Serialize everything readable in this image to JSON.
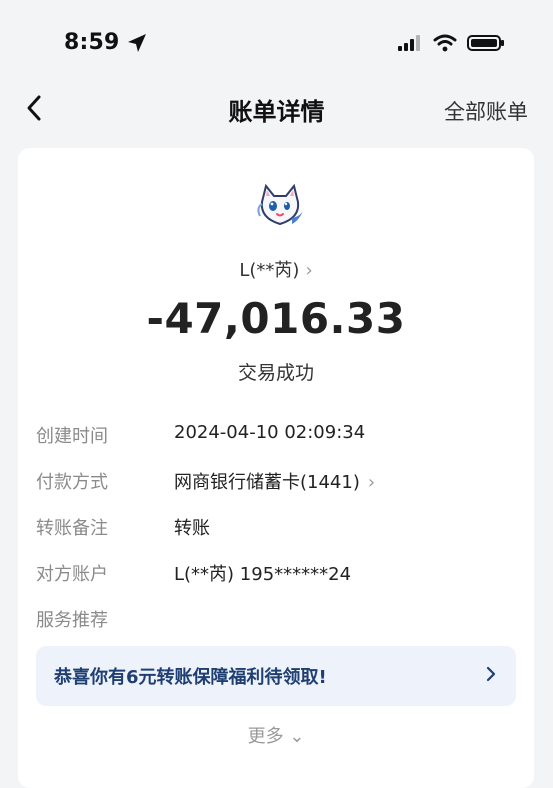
{
  "status_bar": {
    "time": "8:59",
    "icons": [
      "location-arrow-icon",
      "signal-icon",
      "wifi-icon",
      "battery-icon"
    ]
  },
  "nav": {
    "back_icon": "chevron-left-icon",
    "title": "账单详情",
    "right_label": "全部账单"
  },
  "transaction": {
    "avatar_icon": "cat-avatar-icon",
    "payee": "L(**芮)",
    "amount": "-47,016.33",
    "status": "交易成功"
  },
  "details": [
    {
      "label": "创建时间",
      "value": "2024-04-10 02:09:34"
    },
    {
      "label": "付款方式",
      "value": "网商银行储蓄卡(1441)"
    },
    {
      "label": "转账备注",
      "value": "转账"
    },
    {
      "label": "对方账户",
      "value": "L(**芮) 195******24"
    },
    {
      "label": "服务推荐",
      "value": ""
    }
  ],
  "promo": {
    "text": "恭喜你有6元转账保障福利待领取!"
  },
  "more": {
    "label": "更多"
  },
  "colors": {
    "page_background": "#f3f4f6",
    "card_background": "#ffffff",
    "promo_background": "#eef3fb",
    "promo_text": "#1f3f73",
    "secondary_text": "#8b8b8b"
  }
}
